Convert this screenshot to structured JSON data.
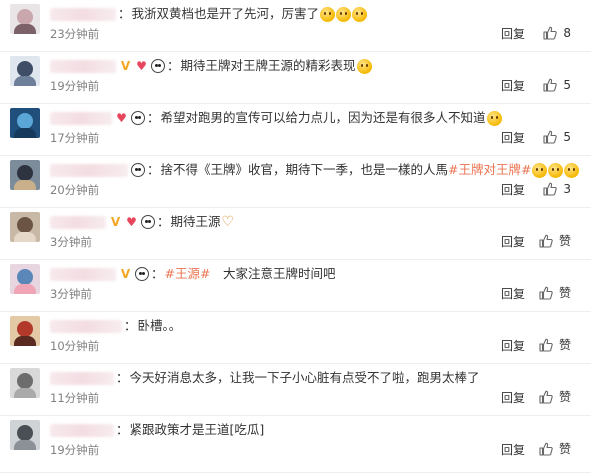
{
  "actions": {
    "reply_label": "回复"
  },
  "comments": [
    {
      "segments": [
        {
          "t": "我浙双黄档也是开了先河，厉害了",
          "c": "text"
        }
      ],
      "emojis": 3,
      "time": "23分钟前",
      "like": "8"
    },
    {
      "segments": [
        {
          "t": "期待王牌对王牌王源的精彩表现",
          "c": "text"
        }
      ],
      "emojis": 1,
      "time": "19分钟前",
      "like": "5"
    },
    {
      "segments": [
        {
          "t": "希望对跑男的宣传可以给力点儿，因为还是有很多人不知道",
          "c": "text"
        }
      ],
      "emojis": 1,
      "time": "17分钟前",
      "like": "5"
    },
    {
      "segments": [
        {
          "t": "捨不得《王牌》收官，期待下一季，也是一樣的人馬",
          "c": "text"
        },
        {
          "t": "#王牌对王牌#",
          "c": "tag"
        }
      ],
      "emojis": 3,
      "time": "20分钟前",
      "like": "3"
    },
    {
      "segments": [
        {
          "t": "期待王源",
          "c": "text"
        }
      ],
      "emojis": 0,
      "heart_emoji": true,
      "time": "3分钟前",
      "like": "赞"
    },
    {
      "segments": [
        {
          "t": "#王源#",
          "c": "tag"
        },
        {
          "t": "　大家注意王牌时间吧",
          "c": "text"
        }
      ],
      "emojis": 0,
      "time": "3分钟前",
      "like": "赞"
    },
    {
      "segments": [
        {
          "t": "卧槽。。",
          "c": "text"
        }
      ],
      "emojis": 0,
      "time": "10分钟前",
      "like": "赞"
    },
    {
      "segments": [
        {
          "t": "今天好消息太多，让我一下子小心脏有点受不了啦，跑男太棒了",
          "c": "text"
        }
      ],
      "emojis": 0,
      "time": "11分钟前",
      "like": "赞"
    },
    {
      "segments": [
        {
          "t": "紧跟政策才是王道[吃瓜]",
          "c": "text"
        }
      ],
      "emojis": 0,
      "time": "19分钟前",
      "like": "赞"
    }
  ]
}
